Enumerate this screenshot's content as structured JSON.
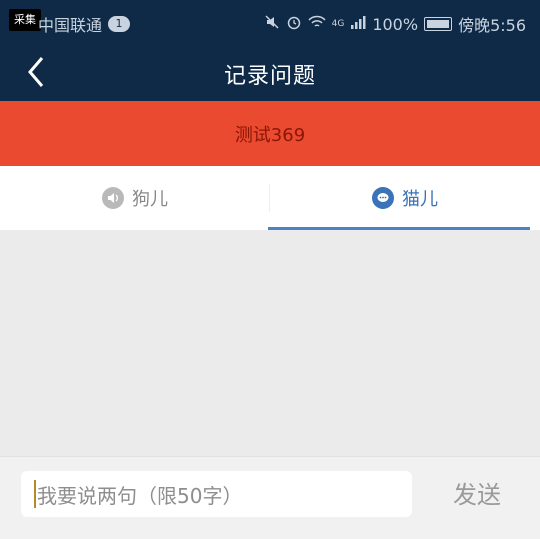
{
  "status_bar": {
    "capture_badge": "采集",
    "carrier": "中国联通",
    "sim_slot": "1",
    "signal_type": "4G",
    "battery": "100%",
    "time": "傍晚5:56",
    "icons": [
      "mute-icon",
      "alarm-icon",
      "wifi-icon",
      "signal-icon",
      "battery-icon"
    ]
  },
  "nav": {
    "back_icon": "chevron-left-icon",
    "title": "记录问题"
  },
  "banner": {
    "text": "测试369"
  },
  "tabs": [
    {
      "label": "狗儿",
      "icon": "speaker-icon",
      "active": false
    },
    {
      "label": "猫儿",
      "icon": "chat-bubble-icon",
      "active": true
    }
  ],
  "input": {
    "placeholder": "我要说两句（限50字）",
    "value": ""
  },
  "send_button": {
    "label": "发送"
  },
  "colors": {
    "nav_bg": "#0f2a47",
    "banner_bg": "#ea4a2f",
    "banner_text": "#8a1606",
    "active_tab": "#3a73b8",
    "content_bg": "#ebebeb"
  }
}
